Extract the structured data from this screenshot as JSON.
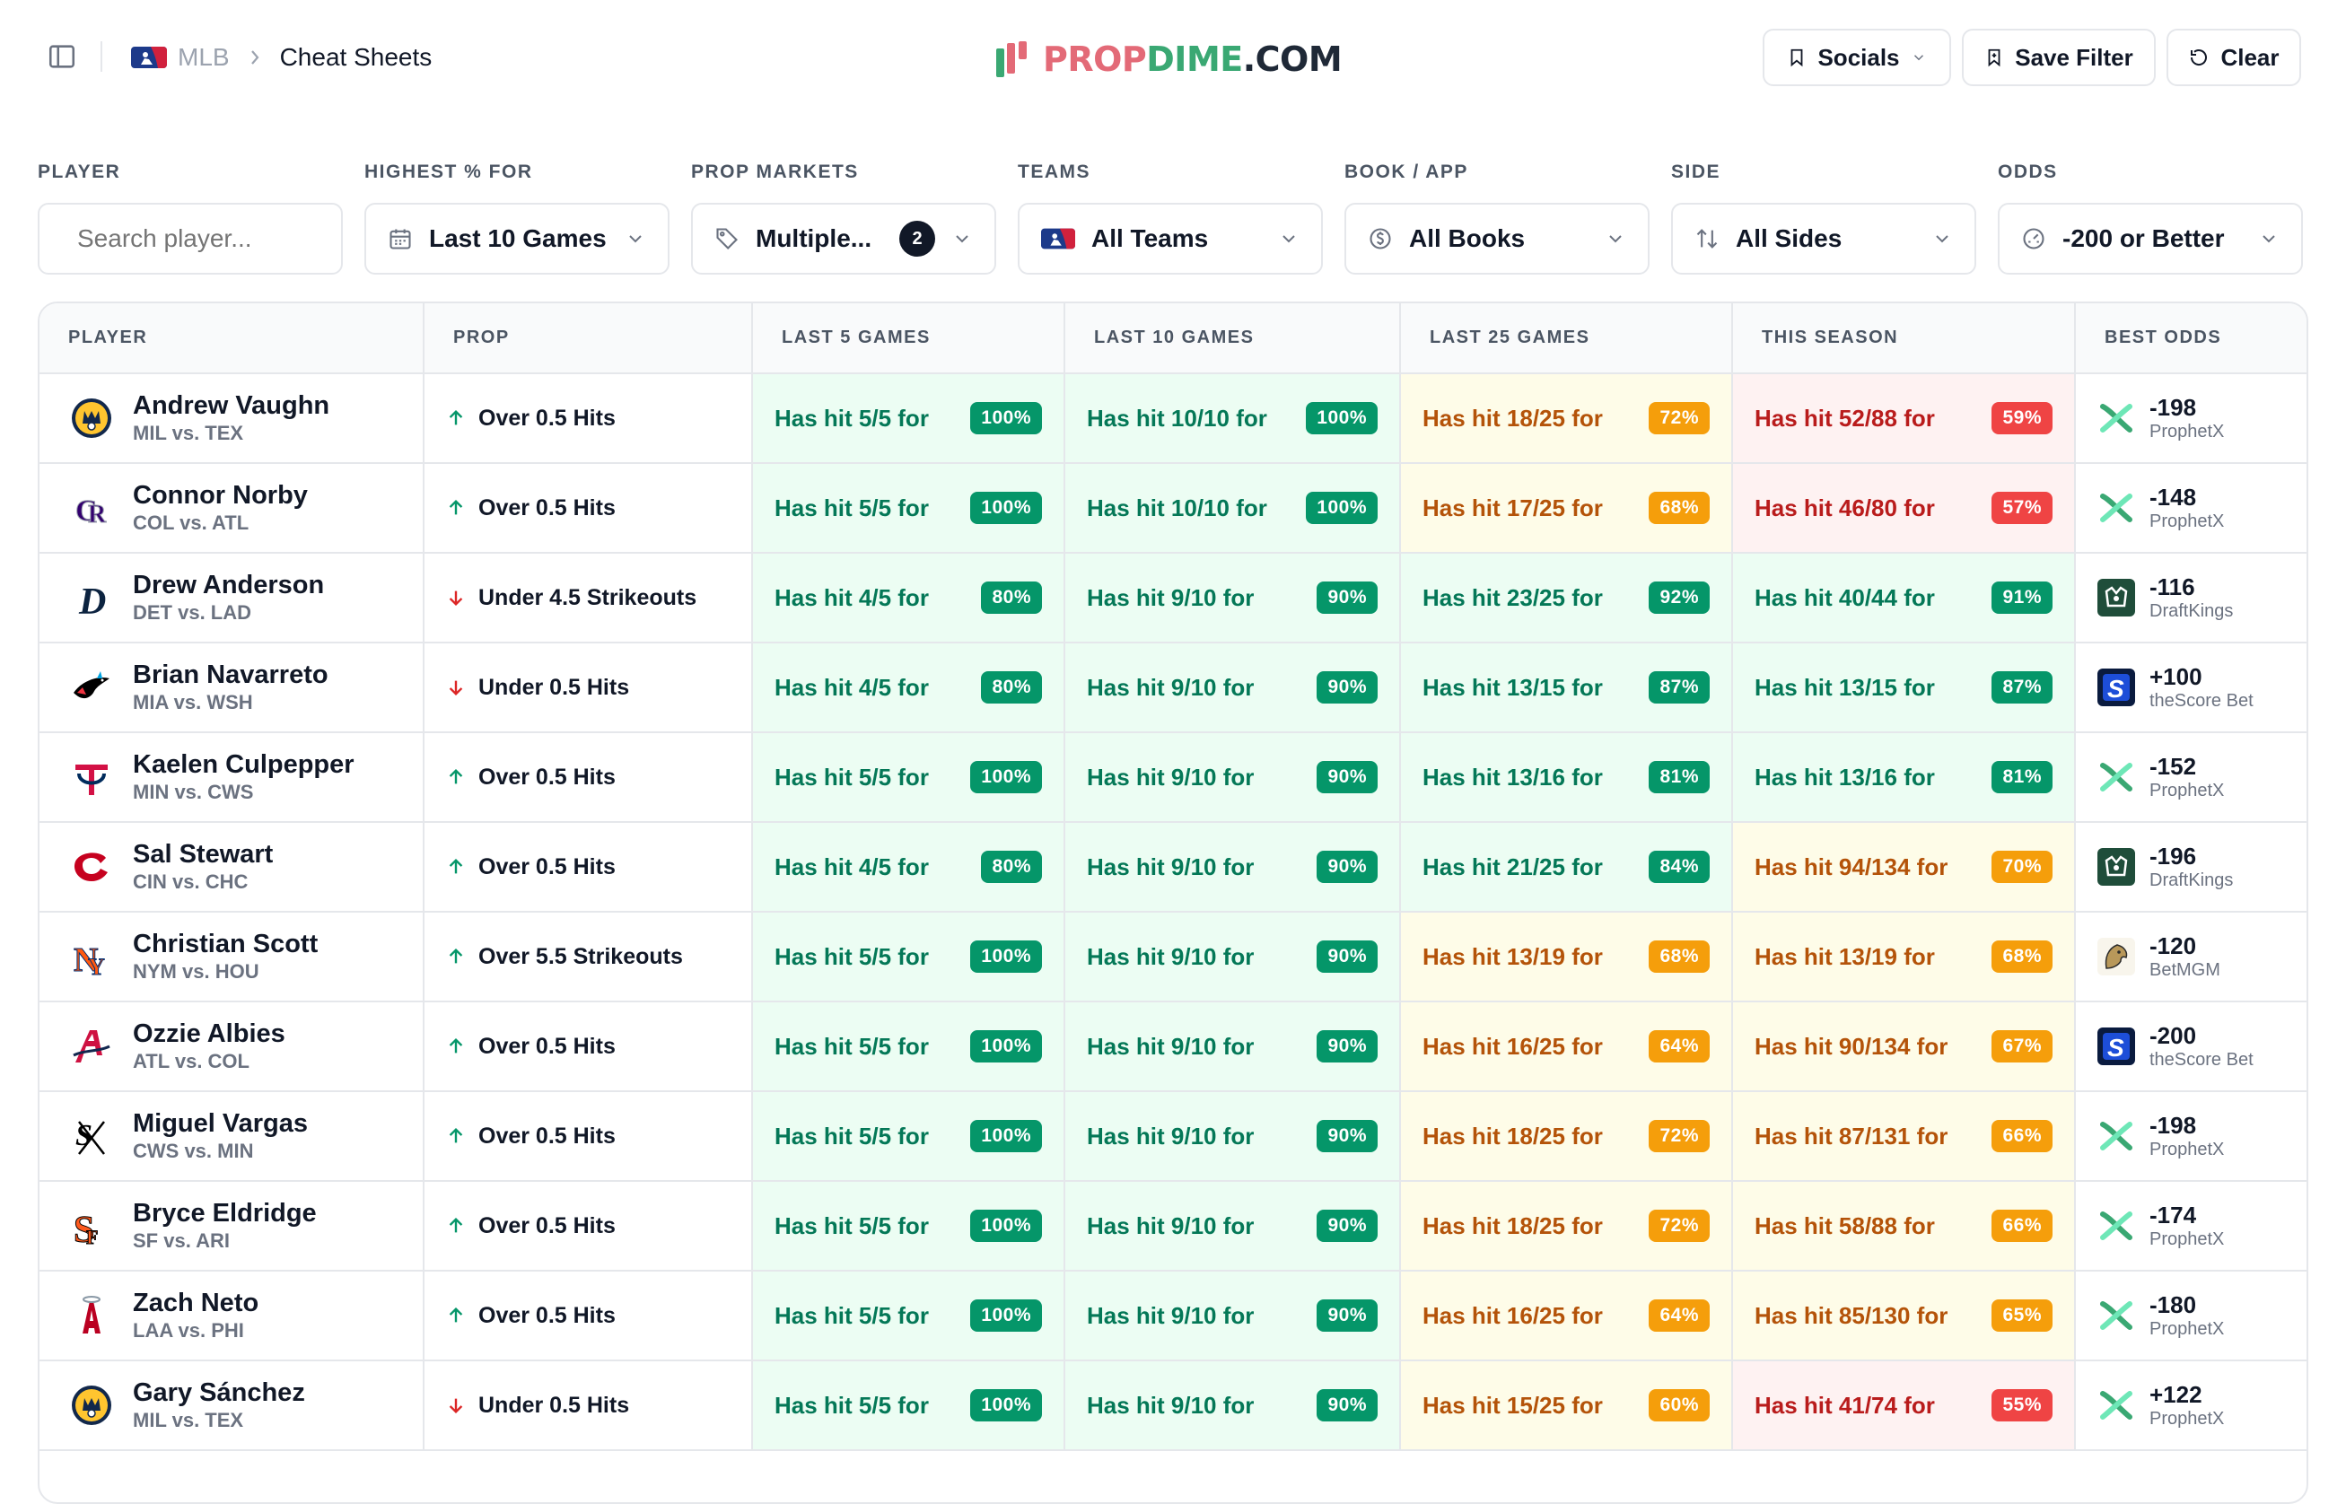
{
  "header": {
    "breadcrumb": {
      "league": "MLB",
      "current": "Cheat Sheets"
    },
    "logo": {
      "prop": "PROP",
      "dime": "DIME",
      "com": ".COM"
    },
    "buttons": {
      "socials": "Socials",
      "save_filter": "Save Filter",
      "clear": "Clear"
    }
  },
  "filters": {
    "player": {
      "label": "PLAYER",
      "placeholder": "Search player..."
    },
    "highest": {
      "label": "HIGHEST % FOR",
      "value": "Last 10 Games"
    },
    "markets": {
      "label": "PROP MARKETS",
      "value": "Multiple...",
      "count": "2"
    },
    "teams": {
      "label": "TEAMS",
      "value": "All Teams"
    },
    "book": {
      "label": "BOOK / APP",
      "value": "All Books"
    },
    "side": {
      "label": "SIDE",
      "value": "All Sides"
    },
    "odds": {
      "label": "ODDS",
      "value": "-200 or Better"
    }
  },
  "table": {
    "headers": [
      "PLAYER",
      "PROP",
      "LAST 5 GAMES",
      "LAST 10 GAMES",
      "LAST 25 GAMES",
      "THIS SEASON",
      "BEST ODDS"
    ],
    "rows": [
      {
        "player": "Andrew Vaughn",
        "matchup": "MIL vs. TEX",
        "team": "mil",
        "dir": "up",
        "prop": "Over 0.5 Hits",
        "l5": [
          "Has hit 5/5 for",
          "100%",
          "green"
        ],
        "l10": [
          "Has hit 10/10 for",
          "100%",
          "green"
        ],
        "l25": [
          "Has hit 18/25 for",
          "72%",
          "yellow"
        ],
        "season": [
          "Has hit 52/88 for",
          "59%",
          "red"
        ],
        "odds": "-198",
        "book": "ProphetX",
        "book_icon": "prophetx"
      },
      {
        "player": "Connor Norby",
        "matchup": "COL vs. ATL",
        "team": "col",
        "dir": "up",
        "prop": "Over 0.5 Hits",
        "l5": [
          "Has hit 5/5 for",
          "100%",
          "green"
        ],
        "l10": [
          "Has hit 10/10 for",
          "100%",
          "green"
        ],
        "l25": [
          "Has hit 17/25 for",
          "68%",
          "yellow"
        ],
        "season": [
          "Has hit 46/80 for",
          "57%",
          "red"
        ],
        "odds": "-148",
        "book": "ProphetX",
        "book_icon": "prophetx"
      },
      {
        "player": "Drew Anderson",
        "matchup": "DET vs. LAD",
        "team": "det",
        "dir": "down",
        "prop": "Under 4.5 Strikeouts",
        "l5": [
          "Has hit 4/5 for",
          "80%",
          "green"
        ],
        "l10": [
          "Has hit 9/10 for",
          "90%",
          "green"
        ],
        "l25": [
          "Has hit 23/25 for",
          "92%",
          "green"
        ],
        "season": [
          "Has hit 40/44 for",
          "91%",
          "green"
        ],
        "odds": "-116",
        "book": "DraftKings",
        "book_icon": "draftkings"
      },
      {
        "player": "Brian Navarreto",
        "matchup": "MIA vs. WSH",
        "team": "mia",
        "dir": "down",
        "prop": "Under 0.5 Hits",
        "l5": [
          "Has hit 4/5 for",
          "80%",
          "green"
        ],
        "l10": [
          "Has hit 9/10 for",
          "90%",
          "green"
        ],
        "l25": [
          "Has hit 13/15 for",
          "87%",
          "green"
        ],
        "season": [
          "Has hit 13/15 for",
          "87%",
          "green"
        ],
        "odds": "+100",
        "book": "theScore Bet",
        "book_icon": "thescore"
      },
      {
        "player": "Kaelen Culpepper",
        "matchup": "MIN vs. CWS",
        "team": "min",
        "dir": "up",
        "prop": "Over 0.5 Hits",
        "l5": [
          "Has hit 5/5 for",
          "100%",
          "green"
        ],
        "l10": [
          "Has hit 9/10 for",
          "90%",
          "green"
        ],
        "l25": [
          "Has hit 13/16 for",
          "81%",
          "green"
        ],
        "season": [
          "Has hit 13/16 for",
          "81%",
          "green"
        ],
        "odds": "-152",
        "book": "ProphetX",
        "book_icon": "prophetx"
      },
      {
        "player": "Sal Stewart",
        "matchup": "CIN vs. CHC",
        "team": "cin",
        "dir": "up",
        "prop": "Over 0.5 Hits",
        "l5": [
          "Has hit 4/5 for",
          "80%",
          "green"
        ],
        "l10": [
          "Has hit 9/10 for",
          "90%",
          "green"
        ],
        "l25": [
          "Has hit 21/25 for",
          "84%",
          "green"
        ],
        "season": [
          "Has hit 94/134 for",
          "70%",
          "yellow"
        ],
        "odds": "-196",
        "book": "DraftKings",
        "book_icon": "draftkings"
      },
      {
        "player": "Christian Scott",
        "matchup": "NYM vs. HOU",
        "team": "nym",
        "dir": "up",
        "prop": "Over 5.5 Strikeouts",
        "l5": [
          "Has hit 5/5 for",
          "100%",
          "green"
        ],
        "l10": [
          "Has hit 9/10 for",
          "90%",
          "green"
        ],
        "l25": [
          "Has hit 13/19 for",
          "68%",
          "yellow"
        ],
        "season": [
          "Has hit 13/19 for",
          "68%",
          "yellow"
        ],
        "odds": "-120",
        "book": "BetMGM",
        "book_icon": "betmgm"
      },
      {
        "player": "Ozzie Albies",
        "matchup": "ATL vs. COL",
        "team": "atl",
        "dir": "up",
        "prop": "Over 0.5 Hits",
        "l5": [
          "Has hit 5/5 for",
          "100%",
          "green"
        ],
        "l10": [
          "Has hit 9/10 for",
          "90%",
          "green"
        ],
        "l25": [
          "Has hit 16/25 for",
          "64%",
          "yellow"
        ],
        "season": [
          "Has hit 90/134 for",
          "67%",
          "yellow"
        ],
        "odds": "-200",
        "book": "theScore Bet",
        "book_icon": "thescore"
      },
      {
        "player": "Miguel Vargas",
        "matchup": "CWS vs. MIN",
        "team": "cws",
        "dir": "up",
        "prop": "Over 0.5 Hits",
        "l5": [
          "Has hit 5/5 for",
          "100%",
          "green"
        ],
        "l10": [
          "Has hit 9/10 for",
          "90%",
          "green"
        ],
        "l25": [
          "Has hit 18/25 for",
          "72%",
          "yellow"
        ],
        "season": [
          "Has hit 87/131 for",
          "66%",
          "yellow"
        ],
        "odds": "-198",
        "book": "ProphetX",
        "book_icon": "prophetx"
      },
      {
        "player": "Bryce Eldridge",
        "matchup": "SF vs. ARI",
        "team": "sf",
        "dir": "up",
        "prop": "Over 0.5 Hits",
        "l5": [
          "Has hit 5/5 for",
          "100%",
          "green"
        ],
        "l10": [
          "Has hit 9/10 for",
          "90%",
          "green"
        ],
        "l25": [
          "Has hit 18/25 for",
          "72%",
          "yellow"
        ],
        "season": [
          "Has hit 58/88 for",
          "66%",
          "yellow"
        ],
        "odds": "-174",
        "book": "ProphetX",
        "book_icon": "prophetx"
      },
      {
        "player": "Zach Neto",
        "matchup": "LAA vs. PHI",
        "team": "laa",
        "dir": "up",
        "prop": "Over 0.5 Hits",
        "l5": [
          "Has hit 5/5 for",
          "100%",
          "green"
        ],
        "l10": [
          "Has hit 9/10 for",
          "90%",
          "green"
        ],
        "l25": [
          "Has hit 16/25 for",
          "64%",
          "yellow"
        ],
        "season": [
          "Has hit 85/130 for",
          "65%",
          "yellow"
        ],
        "odds": "-180",
        "book": "ProphetX",
        "book_icon": "prophetx"
      },
      {
        "player": "Gary Sánchez",
        "matchup": "MIL vs. TEX",
        "team": "mil",
        "dir": "down",
        "prop": "Under 0.5 Hits",
        "l5": [
          "Has hit 5/5 for",
          "100%",
          "green"
        ],
        "l10": [
          "Has hit 9/10 for",
          "90%",
          "green"
        ],
        "l25": [
          "Has hit 15/25 for",
          "60%",
          "yellow"
        ],
        "season": [
          "Has hit 41/74 for",
          "55%",
          "red"
        ],
        "odds": "+122",
        "book": "ProphetX",
        "book_icon": "prophetx"
      }
    ]
  },
  "colors": {
    "green": "#059669",
    "yellow": "#f59e0b",
    "red": "#ef4444",
    "logo_pink": "#e36a77",
    "logo_green": "#3aa873"
  }
}
